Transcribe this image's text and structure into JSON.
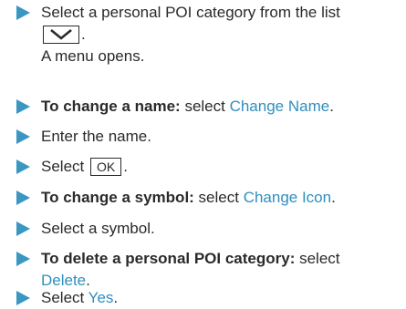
{
  "accent": "#3a97c2",
  "link_color": "#2f8fbd",
  "steps": [
    {
      "text": "Select a personal POI category from the list",
      "cont_icon": "chevron-down-icon",
      "cont_suffix": ".",
      "result": "A menu opens."
    },
    {
      "bold": "To change a name:",
      "text": " select ",
      "link": "Change Name",
      "end": "."
    },
    {
      "text": "Enter the name."
    },
    {
      "text": "Select ",
      "key": "OK",
      "end": "."
    },
    {
      "bold": "To change a symbol:",
      "text": " select ",
      "link": "Change Icon",
      "end": "."
    },
    {
      "text": "Select a symbol."
    },
    {
      "bold": "To delete a personal POI category:",
      "text": " select",
      "link": "Delete",
      "end": "."
    },
    {
      "text": "Select ",
      "link": "Yes",
      "end": "."
    }
  ]
}
